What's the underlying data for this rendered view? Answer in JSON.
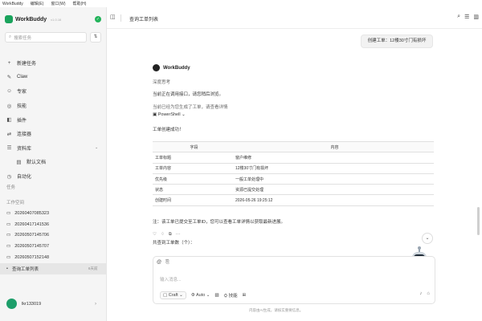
{
  "menu": [
    "WorkBuddy",
    "编辑(E)",
    "窗口(W)",
    "帮助(H)"
  ],
  "brand": {
    "name": "WorkBuddy",
    "version": "v1.0.16"
  },
  "search": {
    "placeholder": "搜索任务"
  },
  "nav": [
    {
      "label": "新建任务",
      "icon": "plus-icon"
    },
    {
      "label": "Claw",
      "icon": "claw-icon"
    },
    {
      "label": "专家",
      "icon": "expert-icon"
    },
    {
      "label": "技能",
      "icon": "skill-icon"
    },
    {
      "label": "插件",
      "icon": "plugin-icon"
    },
    {
      "label": "连接器",
      "icon": "connector-icon"
    },
    {
      "label": "资料库",
      "icon": "library-icon"
    },
    {
      "label": "默认文档",
      "icon": "doc-icon"
    },
    {
      "label": "自动化",
      "icon": "clock-icon"
    }
  ],
  "sections": {
    "tasks": "任务",
    "workspace": "工作空间"
  },
  "tasks": [
    {
      "label": "20260407085323"
    },
    {
      "label": "20260417141536"
    },
    {
      "label": "20260507145706"
    },
    {
      "label": "20260507145707"
    },
    {
      "label": "20260507152148"
    },
    {
      "label": "查询工单列表",
      "time": "6天前"
    }
  ],
  "user": {
    "name": "lkr133019"
  },
  "header": {
    "title": "查询工单列表"
  },
  "chat": {
    "user_message": "创建工单：12楼30寸门有损坏",
    "assistant": "WorkBuddy",
    "line1": "深度思考",
    "line2": "当前正在调用接口，请您稍后浏览。",
    "line3": "当前已经为您生成了工单，请查看详情",
    "tool": "PowerShell",
    "line4": "工单创建成功！",
    "table_header": [
      "字段",
      "内容"
    ],
    "rows": [
      [
        "工单标题",
        "窗户维修"
      ],
      [
        "工单内容",
        "12楼30寸门有损坏"
      ],
      [
        "优先级",
        "一般工单处理中"
      ],
      [
        "状态",
        "资源已提交处理"
      ],
      [
        "创建时间",
        "2026-05-26 19:25:12"
      ]
    ],
    "note": "注：该工单已提交至工单ID，您可以查看工单详情以获取最新进展。",
    "followup": "共查到工单数（个）："
  },
  "composer": {
    "placeholder": "输入消息...",
    "mode": "Craft",
    "model": "Auto",
    "skill": "技能"
  },
  "footnote": "内容由AI生成，请核实重要信息。"
}
